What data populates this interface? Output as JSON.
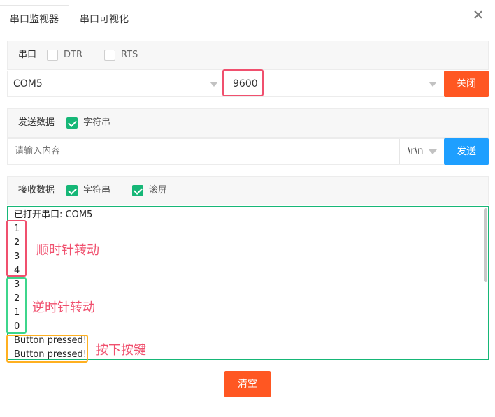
{
  "tabs": [
    {
      "label": "串口监视器",
      "active": true
    },
    {
      "label": "串口可视化",
      "active": false
    }
  ],
  "serial": {
    "section_label": "串口",
    "dtr_label": "DTR",
    "rts_label": "RTS",
    "port_value": "COM5",
    "baud_value": "9600",
    "close_button": "关闭"
  },
  "send": {
    "section_label": "发送数据",
    "string_label": "字符串",
    "input_placeholder": "请输入内容",
    "line_ending": "\\r\\n",
    "send_button": "发送"
  },
  "receive": {
    "section_label": "接收数据",
    "string_label": "字符串",
    "scroll_label": "滚屏",
    "lines": [
      "已打开串口: COM5",
      "1",
      "2",
      "3",
      "4",
      "3",
      "2",
      "1",
      "0",
      "Button pressed!",
      "Button pressed!"
    ],
    "clear_button": "清空"
  },
  "annotations": {
    "clockwise": "顺时针转动",
    "counterclockwise": "逆时针转动",
    "button_press": "按下按键"
  },
  "colors": {
    "accent_orange": "#ff5722",
    "accent_blue": "#1e9fff",
    "check_green": "#16b777",
    "highlight_red": "#f0506e",
    "highlight_green": "#3dd68c",
    "highlight_orange": "#ffb020"
  }
}
